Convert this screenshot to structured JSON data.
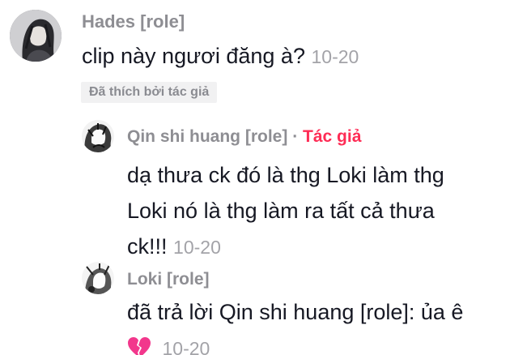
{
  "comments": [
    {
      "avatar_icon": "dark-portrait-avatar",
      "author": "Hades [role]",
      "text": "clip này ngươi đăng à?",
      "time": "10-20",
      "liked_badge": "Đã thích bởi tác giả"
    }
  ],
  "replies": [
    {
      "avatar_icon": "manga-portrait-avatar",
      "author": "Qin shi huang [role]",
      "separator": "·",
      "author_tag": "Tác giả",
      "text_lines": [
        "dạ thưa ck đó là thg Loki làm thg",
        "Loki nó là thg làm ra tất cả thưa",
        "ck!!!"
      ],
      "time": "10-20"
    },
    {
      "avatar_icon": "manga-portrait-avatar",
      "author": "Loki [role]",
      "text_line": "đã trả lời Qin shi huang [role]: ủa ê",
      "emoji_icon": "broken-heart-icon",
      "time": "10-20"
    }
  ],
  "colors": {
    "author_name": "#8e8e93",
    "body_text": "#161823",
    "timestamp": "#a3a3a8",
    "author_tag": "#fe2c55",
    "badge_bg": "#f1f1f2",
    "broken_heart": "#f2378c"
  }
}
